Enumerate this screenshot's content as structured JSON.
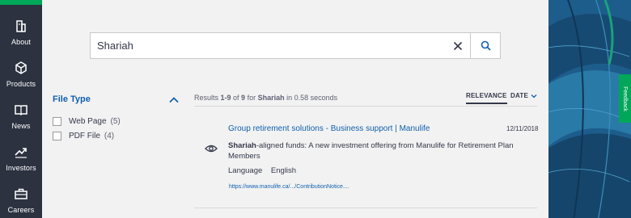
{
  "nav": {
    "items": [
      {
        "label": "About",
        "icon": "building-icon"
      },
      {
        "label": "Products",
        "icon": "cube-icon"
      },
      {
        "label": "News",
        "icon": "book-icon"
      },
      {
        "label": "Investors",
        "icon": "trend-icon"
      },
      {
        "label": "Careers",
        "icon": "briefcase-icon"
      }
    ]
  },
  "search": {
    "value": "Shariah"
  },
  "filters": {
    "title": "File Type",
    "options": [
      {
        "name": "Web Page",
        "count": "(5)"
      },
      {
        "name": "PDF File",
        "count": "(4)"
      }
    ]
  },
  "results": {
    "summary": {
      "prefix": "Results ",
      "range": "1-9",
      "of": " of ",
      "total": "9",
      "for": " for ",
      "query": "Shariah",
      "time": " in 0.58 seconds"
    },
    "sort": {
      "relevance": "RELEVANCE",
      "date": "DATE"
    },
    "items": [
      {
        "title": "Group retirement solutions - Business support | Manulife",
        "date": "12/11/2018",
        "snippet_bold": "Shariah",
        "snippet_rest": "-aligned funds: A new investment offering from Manulife for Retirement Plan Members",
        "meta_label": "Language",
        "meta_value": "English",
        "url": "https://www.manulife.ca/.../ContributionNotice...."
      }
    ]
  },
  "feedback": {
    "label": "Feedback"
  },
  "colors": {
    "accent": "#00a758",
    "link": "#0f5faf",
    "rail": "#2c3240"
  }
}
